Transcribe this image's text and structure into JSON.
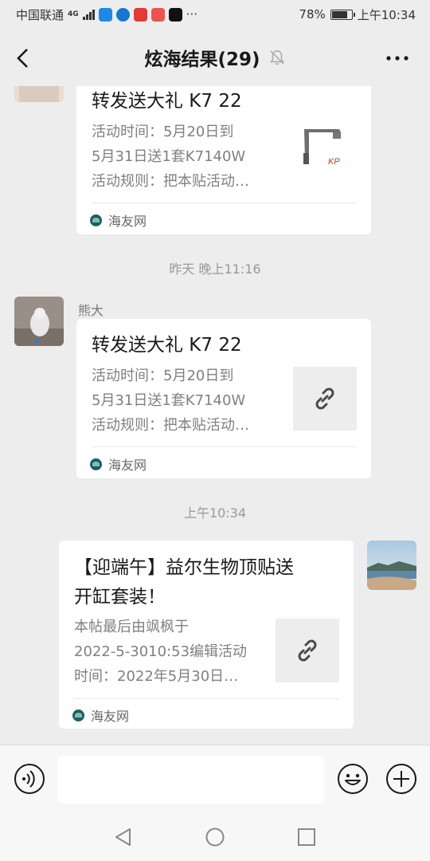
{
  "status_bar": {
    "carrier": "中国联通",
    "network": "4G",
    "battery": "78%",
    "time": "上午10:34",
    "more": "···"
  },
  "header": {
    "title": "炫海结果(29)"
  },
  "messages": [
    {
      "card_title": "转发送大礼 K7 22",
      "desc_line1": "活动时间：5月20日到",
      "desc_line2": "5月31日送1套K7140W",
      "desc_line3": "活动规则：把本贴活动…",
      "source": "海友网"
    },
    {
      "timestamp": "昨天 晚上11:16",
      "sender": "熊大",
      "card_title": "转发送大礼 K7 22",
      "desc_line1": "活动时间：5月20日到",
      "desc_line2": "5月31日送1套K7140W",
      "desc_line3": "活动规则：把本贴活动…",
      "source": "海友网"
    },
    {
      "timestamp": "上午10:34",
      "card_title_line1": "【迎端午】益尔生物顶贴送",
      "card_title_line2": "开缸套装！",
      "desc_line1": "本帖最后由飒枫于",
      "desc_line2": "2022-5-3010:53编辑活动",
      "desc_line3": "时间：2022年5月30日…",
      "source": "海友网"
    }
  ],
  "colors": {
    "background": "#ededed",
    "card": "#ffffff",
    "link_thumb_bg": "#ededed",
    "source_icon": "#1d5d6b"
  },
  "icons": {
    "back": "chevron-left-icon",
    "mute": "bell-off-icon",
    "more": "more-dots-icon",
    "link": "link-icon",
    "voice": "voice-icon",
    "emoji": "emoji-icon",
    "plus": "plus-icon"
  }
}
